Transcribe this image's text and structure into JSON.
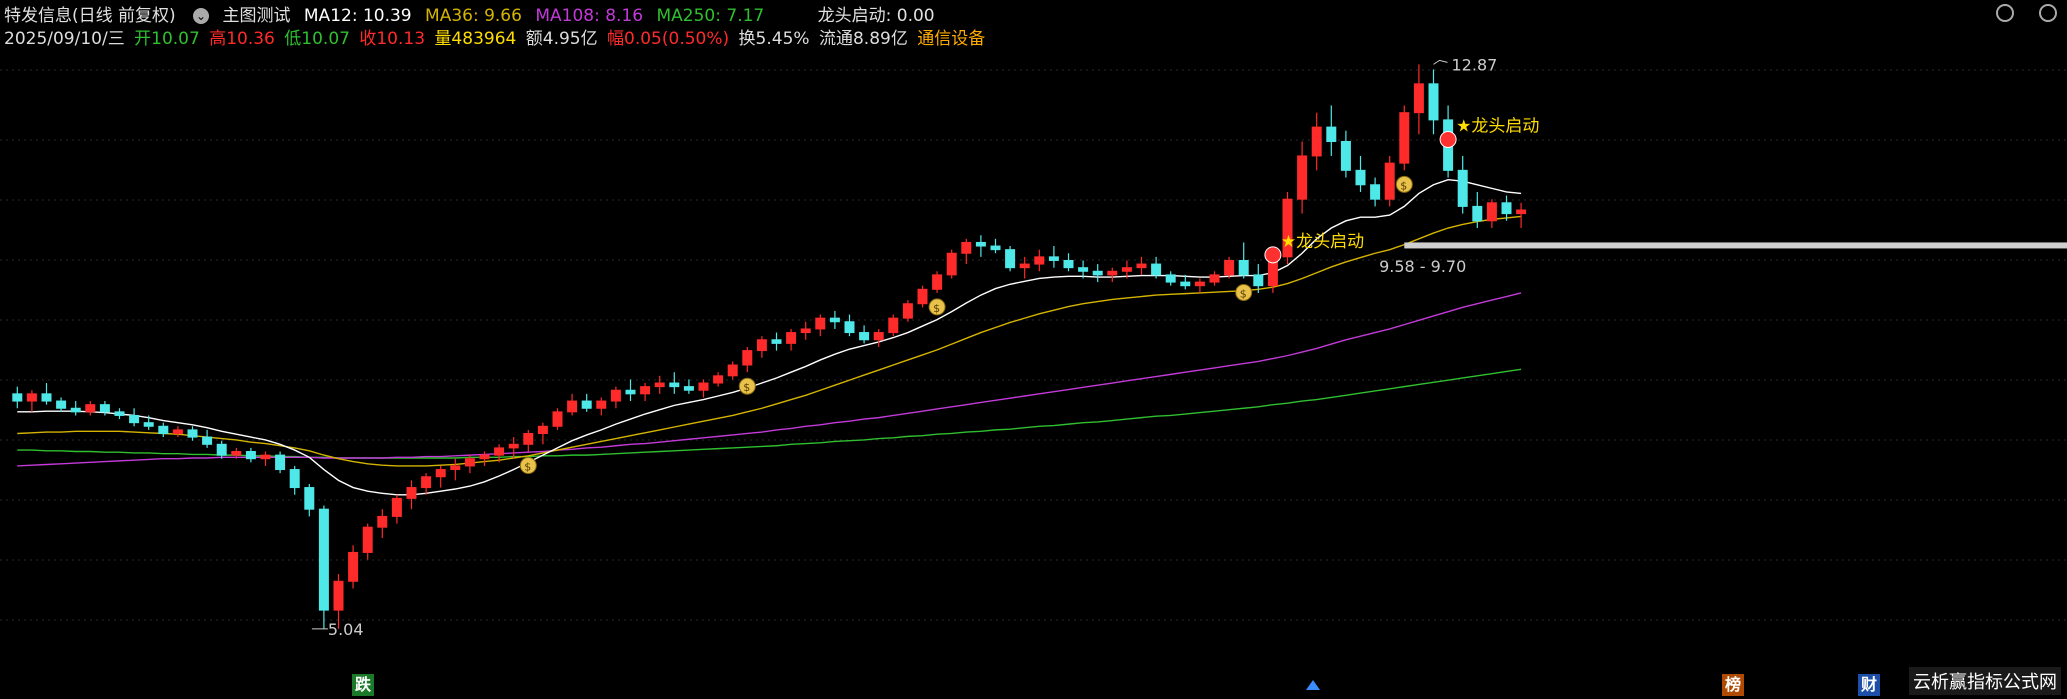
{
  "header": {
    "title": "特发信息(日线 前复权)",
    "indicator_name": "主图测试",
    "ma12": "MA12: 10.39",
    "ma36": "MA36: 9.66",
    "ma108": "MA108: 8.16",
    "ma250": "MA250: 7.17",
    "signal": "龙头启动: 0.00"
  },
  "quote": {
    "date": "2025/09/10/三",
    "open": "开10.07",
    "high": "高10.36",
    "low": "低10.07",
    "close": "收10.13",
    "volume": "量483964",
    "amount": "额4.95亿",
    "change": "幅0.05(0.50%)",
    "turnover": "换5.45%",
    "float_cap": "流通8.89亿",
    "industry": "通信设备"
  },
  "annotations": {
    "high_price": "12.87",
    "low_price": "5.04",
    "support_range": "9.58 - 9.70",
    "dragon_label": "★龙头启动"
  },
  "badges": {
    "fall": "跌",
    "rank": "榜",
    "finance": "财"
  },
  "brand": "云析赢指标公式网",
  "colors": {
    "up": "#ff2a2a",
    "down": "#4fe8e8",
    "ma12": "#ffffff",
    "ma36": "#d4b400",
    "ma108": "#c23ad8",
    "ma250": "#2fbf2f",
    "signal": "#ffdd00"
  },
  "chart_data": {
    "type": "candlestick",
    "y_range": [
      4.4,
      13.0
    ],
    "series_names": [
      "MA12",
      "MA36",
      "MA108",
      "MA250"
    ],
    "ohlc": [
      [
        8.3,
        8.4,
        8.1,
        8.2
      ],
      [
        8.2,
        8.35,
        8.05,
        8.3
      ],
      [
        8.3,
        8.45,
        8.15,
        8.2
      ],
      [
        8.2,
        8.25,
        8.05,
        8.1
      ],
      [
        8.1,
        8.2,
        8.0,
        8.05
      ],
      [
        8.05,
        8.2,
        8.0,
        8.15
      ],
      [
        8.15,
        8.2,
        8.0,
        8.05
      ],
      [
        8.05,
        8.1,
        7.95,
        8.0
      ],
      [
        8.0,
        8.1,
        7.85,
        7.9
      ],
      [
        7.9,
        8.0,
        7.8,
        7.85
      ],
      [
        7.85,
        7.9,
        7.7,
        7.75
      ],
      [
        7.75,
        7.85,
        7.7,
        7.8
      ],
      [
        7.8,
        7.85,
        7.65,
        7.7
      ],
      [
        7.7,
        7.8,
        7.55,
        7.6
      ],
      [
        7.6,
        7.65,
        7.4,
        7.45
      ],
      [
        7.45,
        7.55,
        7.4,
        7.5
      ],
      [
        7.5,
        7.55,
        7.35,
        7.4
      ],
      [
        7.4,
        7.5,
        7.3,
        7.45
      ],
      [
        7.45,
        7.5,
        7.2,
        7.25
      ],
      [
        7.25,
        7.3,
        6.9,
        7.0
      ],
      [
        7.0,
        7.05,
        6.6,
        6.7
      ],
      [
        6.7,
        6.75,
        5.04,
        5.3
      ],
      [
        5.3,
        5.8,
        5.04,
        5.7
      ],
      [
        5.7,
        6.2,
        5.6,
        6.1
      ],
      [
        6.1,
        6.5,
        6.0,
        6.45
      ],
      [
        6.45,
        6.7,
        6.3,
        6.6
      ],
      [
        6.6,
        6.9,
        6.5,
        6.85
      ],
      [
        6.85,
        7.1,
        6.7,
        7.0
      ],
      [
        7.0,
        7.2,
        6.9,
        7.15
      ],
      [
        7.15,
        7.3,
        7.0,
        7.25
      ],
      [
        7.25,
        7.4,
        7.1,
        7.3
      ],
      [
        7.3,
        7.45,
        7.2,
        7.4
      ],
      [
        7.4,
        7.5,
        7.3,
        7.45
      ],
      [
        7.45,
        7.6,
        7.35,
        7.55
      ],
      [
        7.55,
        7.7,
        7.4,
        7.6
      ],
      [
        7.6,
        7.8,
        7.5,
        7.75
      ],
      [
        7.75,
        7.9,
        7.6,
        7.85
      ],
      [
        7.85,
        8.1,
        7.8,
        8.05
      ],
      [
        8.05,
        8.3,
        8.0,
        8.2
      ],
      [
        8.2,
        8.3,
        8.05,
        8.1
      ],
      [
        8.1,
        8.25,
        8.0,
        8.2
      ],
      [
        8.2,
        8.4,
        8.1,
        8.35
      ],
      [
        8.35,
        8.5,
        8.2,
        8.3
      ],
      [
        8.3,
        8.45,
        8.2,
        8.4
      ],
      [
        8.4,
        8.55,
        8.3,
        8.45
      ],
      [
        8.45,
        8.6,
        8.3,
        8.4
      ],
      [
        8.4,
        8.5,
        8.3,
        8.35
      ],
      [
        8.35,
        8.5,
        8.25,
        8.45
      ],
      [
        8.45,
        8.6,
        8.4,
        8.55
      ],
      [
        8.55,
        8.75,
        8.5,
        8.7
      ],
      [
        8.7,
        8.95,
        8.6,
        8.9
      ],
      [
        8.9,
        9.1,
        8.8,
        9.05
      ],
      [
        9.05,
        9.15,
        8.9,
        9.0
      ],
      [
        9.0,
        9.2,
        8.9,
        9.15
      ],
      [
        9.15,
        9.3,
        9.05,
        9.2
      ],
      [
        9.2,
        9.4,
        9.1,
        9.35
      ],
      [
        9.35,
        9.45,
        9.2,
        9.3
      ],
      [
        9.3,
        9.4,
        9.1,
        9.15
      ],
      [
        9.15,
        9.25,
        9.0,
        9.05
      ],
      [
        9.05,
        9.2,
        8.95,
        9.15
      ],
      [
        9.15,
        9.4,
        9.1,
        9.35
      ],
      [
        9.35,
        9.6,
        9.3,
        9.55
      ],
      [
        9.55,
        9.8,
        9.5,
        9.75
      ],
      [
        9.75,
        10.0,
        9.7,
        9.95
      ],
      [
        9.95,
        10.3,
        9.9,
        10.25
      ],
      [
        10.25,
        10.45,
        10.1,
        10.4
      ],
      [
        10.4,
        10.5,
        10.2,
        10.35
      ],
      [
        10.35,
        10.45,
        10.25,
        10.3
      ],
      [
        10.3,
        10.35,
        10.0,
        10.05
      ],
      [
        10.05,
        10.2,
        9.9,
        10.1
      ],
      [
        10.1,
        10.3,
        10.0,
        10.2
      ],
      [
        10.2,
        10.35,
        10.05,
        10.15
      ],
      [
        10.15,
        10.25,
        10.0,
        10.05
      ],
      [
        10.05,
        10.15,
        9.9,
        10.0
      ],
      [
        10.0,
        10.1,
        9.85,
        9.95
      ],
      [
        9.95,
        10.05,
        9.85,
        10.0
      ],
      [
        10.0,
        10.15,
        9.9,
        10.05
      ],
      [
        10.05,
        10.2,
        9.95,
        10.1
      ],
      [
        10.1,
        10.2,
        9.9,
        9.95
      ],
      [
        9.95,
        10.0,
        9.8,
        9.85
      ],
      [
        9.85,
        9.95,
        9.75,
        9.8
      ],
      [
        9.8,
        9.9,
        9.7,
        9.85
      ],
      [
        9.85,
        10.0,
        9.8,
        9.95
      ],
      [
        9.95,
        10.2,
        9.9,
        10.15
      ],
      [
        10.15,
        10.4,
        9.9,
        9.95
      ],
      [
        9.95,
        10.1,
        9.7,
        9.8
      ],
      [
        9.8,
        10.3,
        9.7,
        10.2
      ],
      [
        10.2,
        11.1,
        10.1,
        11.0
      ],
      [
        11.0,
        11.8,
        10.8,
        11.6
      ],
      [
        11.6,
        12.2,
        11.4,
        12.0
      ],
      [
        12.0,
        12.3,
        11.6,
        11.8
      ],
      [
        11.8,
        11.95,
        11.3,
        11.4
      ],
      [
        11.4,
        11.6,
        11.1,
        11.2
      ],
      [
        11.2,
        11.3,
        10.9,
        11.0
      ],
      [
        11.0,
        11.6,
        10.9,
        11.5
      ],
      [
        11.5,
        12.3,
        11.4,
        12.2
      ],
      [
        12.2,
        12.87,
        11.9,
        12.6
      ],
      [
        12.6,
        12.8,
        11.9,
        12.1
      ],
      [
        12.1,
        12.3,
        11.3,
        11.4
      ],
      [
        11.4,
        11.6,
        10.8,
        10.9
      ],
      [
        10.9,
        11.1,
        10.6,
        10.7
      ],
      [
        10.7,
        11.0,
        10.6,
        10.95
      ],
      [
        10.95,
        11.05,
        10.7,
        10.8
      ],
      [
        10.8,
        10.95,
        10.6,
        10.85
      ]
    ],
    "ma12": [
      8.05,
      8.05,
      8.06,
      8.06,
      8.06,
      8.05,
      8.04,
      8.02,
      8.0,
      7.97,
      7.93,
      7.9,
      7.87,
      7.83,
      7.78,
      7.74,
      7.7,
      7.66,
      7.6,
      7.52,
      7.42,
      7.25,
      7.1,
      7.0,
      6.95,
      6.92,
      6.9,
      6.9,
      6.92,
      6.95,
      6.98,
      7.02,
      7.08,
      7.16,
      7.25,
      7.35,
      7.45,
      7.55,
      7.65,
      7.73,
      7.8,
      7.88,
      7.95,
      8.02,
      8.08,
      8.14,
      8.18,
      8.22,
      8.27,
      8.32,
      8.38,
      8.45,
      8.52,
      8.6,
      8.68,
      8.77,
      8.85,
      8.92,
      8.97,
      9.02,
      9.08,
      9.15,
      9.24,
      9.33,
      9.44,
      9.56,
      9.67,
      9.76,
      9.82,
      9.86,
      9.9,
      9.92,
      9.93,
      9.93,
      9.92,
      9.92,
      9.93,
      9.94,
      9.94,
      9.94,
      9.93,
      9.92,
      9.92,
      9.93,
      9.94,
      9.94,
      9.98,
      10.08,
      10.25,
      10.45,
      10.6,
      10.7,
      10.75,
      10.75,
      10.78,
      10.9,
      11.08,
      11.2,
      11.27,
      11.25,
      11.2,
      11.15,
      11.1,
      11.08
    ],
    "ma36": [
      7.75,
      7.76,
      7.77,
      7.77,
      7.78,
      7.78,
      7.78,
      7.78,
      7.77,
      7.76,
      7.75,
      7.74,
      7.72,
      7.7,
      7.68,
      7.66,
      7.63,
      7.61,
      7.58,
      7.55,
      7.51,
      7.45,
      7.4,
      7.36,
      7.33,
      7.31,
      7.3,
      7.3,
      7.3,
      7.31,
      7.32,
      7.34,
      7.36,
      7.38,
      7.41,
      7.44,
      7.48,
      7.52,
      7.56,
      7.6,
      7.64,
      7.68,
      7.72,
      7.76,
      7.8,
      7.84,
      7.88,
      7.92,
      7.96,
      8.0,
      8.05,
      8.1,
      8.16,
      8.22,
      8.28,
      8.35,
      8.42,
      8.49,
      8.56,
      8.63,
      8.7,
      8.77,
      8.84,
      8.91,
      8.99,
      9.07,
      9.15,
      9.22,
      9.29,
      9.35,
      9.41,
      9.46,
      9.51,
      9.55,
      9.58,
      9.61,
      9.63,
      9.65,
      9.67,
      9.68,
      9.69,
      9.7,
      9.71,
      9.72,
      9.73,
      9.75,
      9.78,
      9.83,
      9.9,
      9.98,
      10.06,
      10.13,
      10.19,
      10.25,
      10.3,
      10.37,
      10.45,
      10.53,
      10.6,
      10.65,
      10.69,
      10.72,
      10.74,
      10.76
    ],
    "ma108": [
      7.3,
      7.31,
      7.32,
      7.33,
      7.34,
      7.35,
      7.36,
      7.37,
      7.38,
      7.39,
      7.4,
      7.4,
      7.41,
      7.41,
      7.42,
      7.42,
      7.42,
      7.42,
      7.42,
      7.42,
      7.42,
      7.41,
      7.41,
      7.41,
      7.41,
      7.41,
      7.42,
      7.42,
      7.43,
      7.43,
      7.44,
      7.45,
      7.46,
      7.47,
      7.48,
      7.49,
      7.5,
      7.52,
      7.53,
      7.55,
      7.56,
      7.58,
      7.6,
      7.61,
      7.63,
      7.65,
      7.67,
      7.69,
      7.71,
      7.73,
      7.75,
      7.77,
      7.8,
      7.82,
      7.85,
      7.87,
      7.9,
      7.92,
      7.95,
      7.97,
      8.0,
      8.03,
      8.06,
      8.09,
      8.12,
      8.15,
      8.18,
      8.21,
      8.24,
      8.27,
      8.3,
      8.33,
      8.36,
      8.39,
      8.42,
      8.45,
      8.48,
      8.51,
      8.54,
      8.57,
      8.6,
      8.63,
      8.66,
      8.69,
      8.72,
      8.75,
      8.79,
      8.83,
      8.88,
      8.93,
      8.99,
      9.05,
      9.1,
      9.15,
      9.2,
      9.26,
      9.32,
      9.38,
      9.44,
      9.5,
      9.55,
      9.6,
      9.65,
      9.7
    ],
    "ma250": [
      7.52,
      7.52,
      7.51,
      7.51,
      7.5,
      7.5,
      7.49,
      7.49,
      7.48,
      7.48,
      7.47,
      7.47,
      7.46,
      7.46,
      7.45,
      7.45,
      7.44,
      7.44,
      7.43,
      7.43,
      7.42,
      7.42,
      7.41,
      7.41,
      7.41,
      7.41,
      7.41,
      7.41,
      7.41,
      7.41,
      7.41,
      7.42,
      7.42,
      7.42,
      7.43,
      7.43,
      7.44,
      7.44,
      7.45,
      7.45,
      7.46,
      7.47,
      7.48,
      7.49,
      7.5,
      7.51,
      7.52,
      7.53,
      7.54,
      7.55,
      7.56,
      7.57,
      7.58,
      7.6,
      7.61,
      7.62,
      7.64,
      7.65,
      7.66,
      7.68,
      7.69,
      7.71,
      7.72,
      7.74,
      7.75,
      7.77,
      7.78,
      7.8,
      7.81,
      7.83,
      7.85,
      7.86,
      7.88,
      7.9,
      7.91,
      7.93,
      7.95,
      7.97,
      7.99,
      8.0,
      8.02,
      8.04,
      8.06,
      8.08,
      8.1,
      8.12,
      8.15,
      8.17,
      8.2,
      8.22,
      8.25,
      8.28,
      8.31,
      8.34,
      8.37,
      8.4,
      8.43,
      8.46,
      8.49,
      8.52,
      8.55,
      8.58,
      8.61,
      8.64
    ]
  }
}
